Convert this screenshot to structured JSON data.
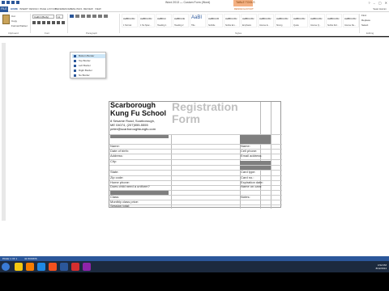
{
  "window": {
    "title": "Word 2013 — Custom Form (Word)",
    "context_tab_group": "TABLE TOOLS",
    "controls": [
      "?",
      "–",
      "▢",
      "✕"
    ],
    "user": "Sean Hamm"
  },
  "ribbon": {
    "file_tab": "FILE",
    "tabs": [
      "HOME",
      "INSERT",
      "DESIGN",
      "PAGE LAYOUT",
      "REFERENCES",
      "MAILINGS",
      "REVIEW",
      "VIEW",
      "DESIGN",
      "LAYOUT"
    ],
    "clipboard": {
      "items": [
        "Cut",
        "Copy",
        "Format Painter"
      ],
      "label": "Clipboard"
    },
    "font": {
      "name": "Calibri (Body)",
      "size": "11",
      "label": "Font"
    },
    "paragraph_label": "Paragraph",
    "styles": [
      {
        "sample": "AaBbCcDc",
        "name": "1 Normal"
      },
      {
        "sample": "AaBbCcDc",
        "name": "1 No Spac..."
      },
      {
        "sample": "AaBbCc",
        "name": "Heading 1"
      },
      {
        "sample": "AaBbCcE",
        "name": "Heading 2"
      },
      {
        "sample": "AaBI",
        "name": "Title",
        "big": true
      },
      {
        "sample": "AaBbCcD",
        "name": "Subtitle"
      },
      {
        "sample": "AaBbCcDc",
        "name": "Subtle Em..."
      },
      {
        "sample": "AaBbCcDc",
        "name": "Emphasis"
      },
      {
        "sample": "AaBbCcDc",
        "name": "Intense E..."
      },
      {
        "sample": "AaBbCcDc",
        "name": "Strong"
      },
      {
        "sample": "AaBbCcDc",
        "name": "Quote"
      },
      {
        "sample": "AaBbCcDc",
        "name": "Intense Q..."
      },
      {
        "sample": "AaBbCcDc",
        "name": "Subtle Ref..."
      },
      {
        "sample": "AaBbCcDc",
        "name": "Intense Re..."
      }
    ],
    "styles_label": "Styles",
    "editing": {
      "items": [
        "Find",
        "Replace",
        "Select"
      ],
      "label": "Editing"
    }
  },
  "dropdown": {
    "items": [
      "Bottom Border",
      "Top Border",
      "Left Border",
      "Right Border",
      "No Border"
    ],
    "highlighted_index": 0
  },
  "document": {
    "school_name": "Scarborough Kung Fu School",
    "address_lines": [
      "8 Sesame Road, Scarborough,",
      "ME 04074, (207)555-5555",
      "peter@scarboroughkungfu.com"
    ],
    "form_title": "Registration Form",
    "left_labels": [
      "Name:",
      "Date of birth:",
      "Address:",
      "City:",
      "State:",
      "Zip code:",
      "Home phone:",
      "Does child need a uniform?",
      "Class:",
      "Monthly class price:",
      "Session total:"
    ],
    "right_labels": [
      "Name:",
      "Cell phone:",
      "Email address:",
      "Card type:",
      "Card no.:",
      "Expiration date:",
      "Name on card:",
      "Notes:"
    ]
  },
  "status": {
    "page": "PAGE 1 OF 1",
    "words": "42 WORDS"
  },
  "taskbar": {
    "time": "4:52 PM",
    "date": "8/12/2014"
  }
}
